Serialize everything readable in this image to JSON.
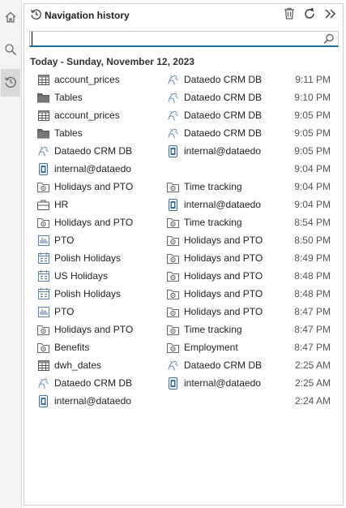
{
  "panel": {
    "title": "Navigation history",
    "date_heading": "Today - Sunday, November 12, 2023",
    "search": {
      "value": "",
      "placeholder": ""
    }
  },
  "rail": [
    "home-icon",
    "search-icon",
    "history-icon"
  ],
  "header_actions": [
    "trash-icon",
    "refresh-icon",
    "double-chevron-right-icon"
  ],
  "rows": [
    {
      "c1": {
        "icon": "table",
        "label": "account_prices"
      },
      "c2": {
        "icon": "database",
        "label": "Dataedo CRM DB"
      },
      "time": "9:11 PM"
    },
    {
      "c1": {
        "icon": "folder",
        "label": "Tables"
      },
      "c2": {
        "icon": "database",
        "label": "Dataedo CRM DB"
      },
      "time": "9:10 PM"
    },
    {
      "c1": {
        "icon": "table",
        "label": "account_prices"
      },
      "c2": {
        "icon": "database",
        "label": "Dataedo CRM DB"
      },
      "time": "9:05 PM"
    },
    {
      "c1": {
        "icon": "folder",
        "label": "Tables"
      },
      "c2": {
        "icon": "database",
        "label": "Dataedo CRM DB"
      },
      "time": "9:05 PM"
    },
    {
      "c1": {
        "icon": "database",
        "label": "Dataedo CRM DB"
      },
      "c2": {
        "icon": "repository",
        "label": "internal@dataedo"
      },
      "time": "9:05 PM"
    },
    {
      "c1": {
        "icon": "repository",
        "label": "internal@dataedo"
      },
      "c2": null,
      "time": "9:04 PM"
    },
    {
      "c1": {
        "icon": "glossary",
        "label": "Holidays and PTO"
      },
      "c2": {
        "icon": "glossary",
        "label": "Time tracking"
      },
      "time": "9:04 PM"
    },
    {
      "c1": {
        "icon": "domain",
        "label": "HR"
      },
      "c2": {
        "icon": "repository",
        "label": "internal@dataedo"
      },
      "time": "9:04 PM"
    },
    {
      "c1": {
        "icon": "glossary",
        "label": "Holidays and PTO"
      },
      "c2": {
        "icon": "glossary",
        "label": "Time tracking"
      },
      "time": "8:54 PM"
    },
    {
      "c1": {
        "icon": "report",
        "label": "PTO"
      },
      "c2": {
        "icon": "glossary",
        "label": "Holidays and PTO"
      },
      "time": "8:50 PM"
    },
    {
      "c1": {
        "icon": "calendar",
        "label": "Polish Holidays"
      },
      "c2": {
        "icon": "glossary",
        "label": "Holidays and PTO"
      },
      "time": "8:49 PM"
    },
    {
      "c1": {
        "icon": "calendar",
        "label": "US Holidays"
      },
      "c2": {
        "icon": "glossary",
        "label": "Holidays and PTO"
      },
      "time": "8:48 PM"
    },
    {
      "c1": {
        "icon": "calendar",
        "label": "Polish Holidays"
      },
      "c2": {
        "icon": "glossary",
        "label": "Holidays and PTO"
      },
      "time": "8:48 PM"
    },
    {
      "c1": {
        "icon": "report",
        "label": "PTO"
      },
      "c2": {
        "icon": "glossary",
        "label": "Holidays and PTO"
      },
      "time": "8:47 PM"
    },
    {
      "c1": {
        "icon": "glossary",
        "label": "Holidays and PTO"
      },
      "c2": {
        "icon": "glossary",
        "label": "Time tracking"
      },
      "time": "8:47 PM"
    },
    {
      "c1": {
        "icon": "glossary",
        "label": "Benefits"
      },
      "c2": {
        "icon": "glossary",
        "label": "Employment"
      },
      "time": "8:47 PM"
    },
    {
      "c1": {
        "icon": "table",
        "label": "dwh_dates"
      },
      "c2": {
        "icon": "database",
        "label": "Dataedo CRM DB"
      },
      "time": "2:25 AM"
    },
    {
      "c1": {
        "icon": "database",
        "label": "Dataedo CRM DB"
      },
      "c2": {
        "icon": "repository",
        "label": "internal@dataedo"
      },
      "time": "2:25 AM"
    },
    {
      "c1": {
        "icon": "repository",
        "label": "internal@dataedo"
      },
      "c2": null,
      "time": "2:24 AM"
    }
  ]
}
